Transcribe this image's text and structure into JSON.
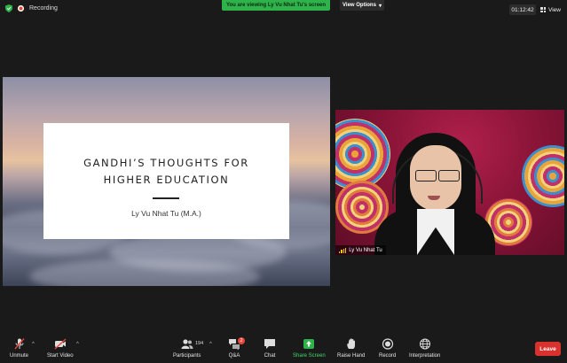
{
  "top": {
    "recording_label": "Recording",
    "banner_text": "You are viewing Ly Vu Nhat Tu's screen",
    "view_options_label": "View Options",
    "timer": "01:12:42",
    "view_label": "View"
  },
  "slide": {
    "title_line1": "GANDHI’S THOUGHTS FOR",
    "title_line2": "HIGHER EDUCATION",
    "subtitle": "Ly Vu Nhat Tu (M.A.)"
  },
  "video": {
    "participant_name": "Ly Vu Nhat Tu"
  },
  "toolbar": {
    "unmute": "Unmute",
    "start_video": "Start Video",
    "participants": "Participants",
    "participant_count": "194",
    "qa": "Q&A",
    "qa_badge": "2",
    "chat": "Chat",
    "share_screen": "Share Screen",
    "raise_hand": "Raise Hand",
    "record": "Record",
    "interpretation": "Interpretation",
    "leave": "Leave"
  },
  "colors": {
    "banner": "#2db34a",
    "share_accent": "#3ddc6a",
    "leave": "#d9322e"
  }
}
